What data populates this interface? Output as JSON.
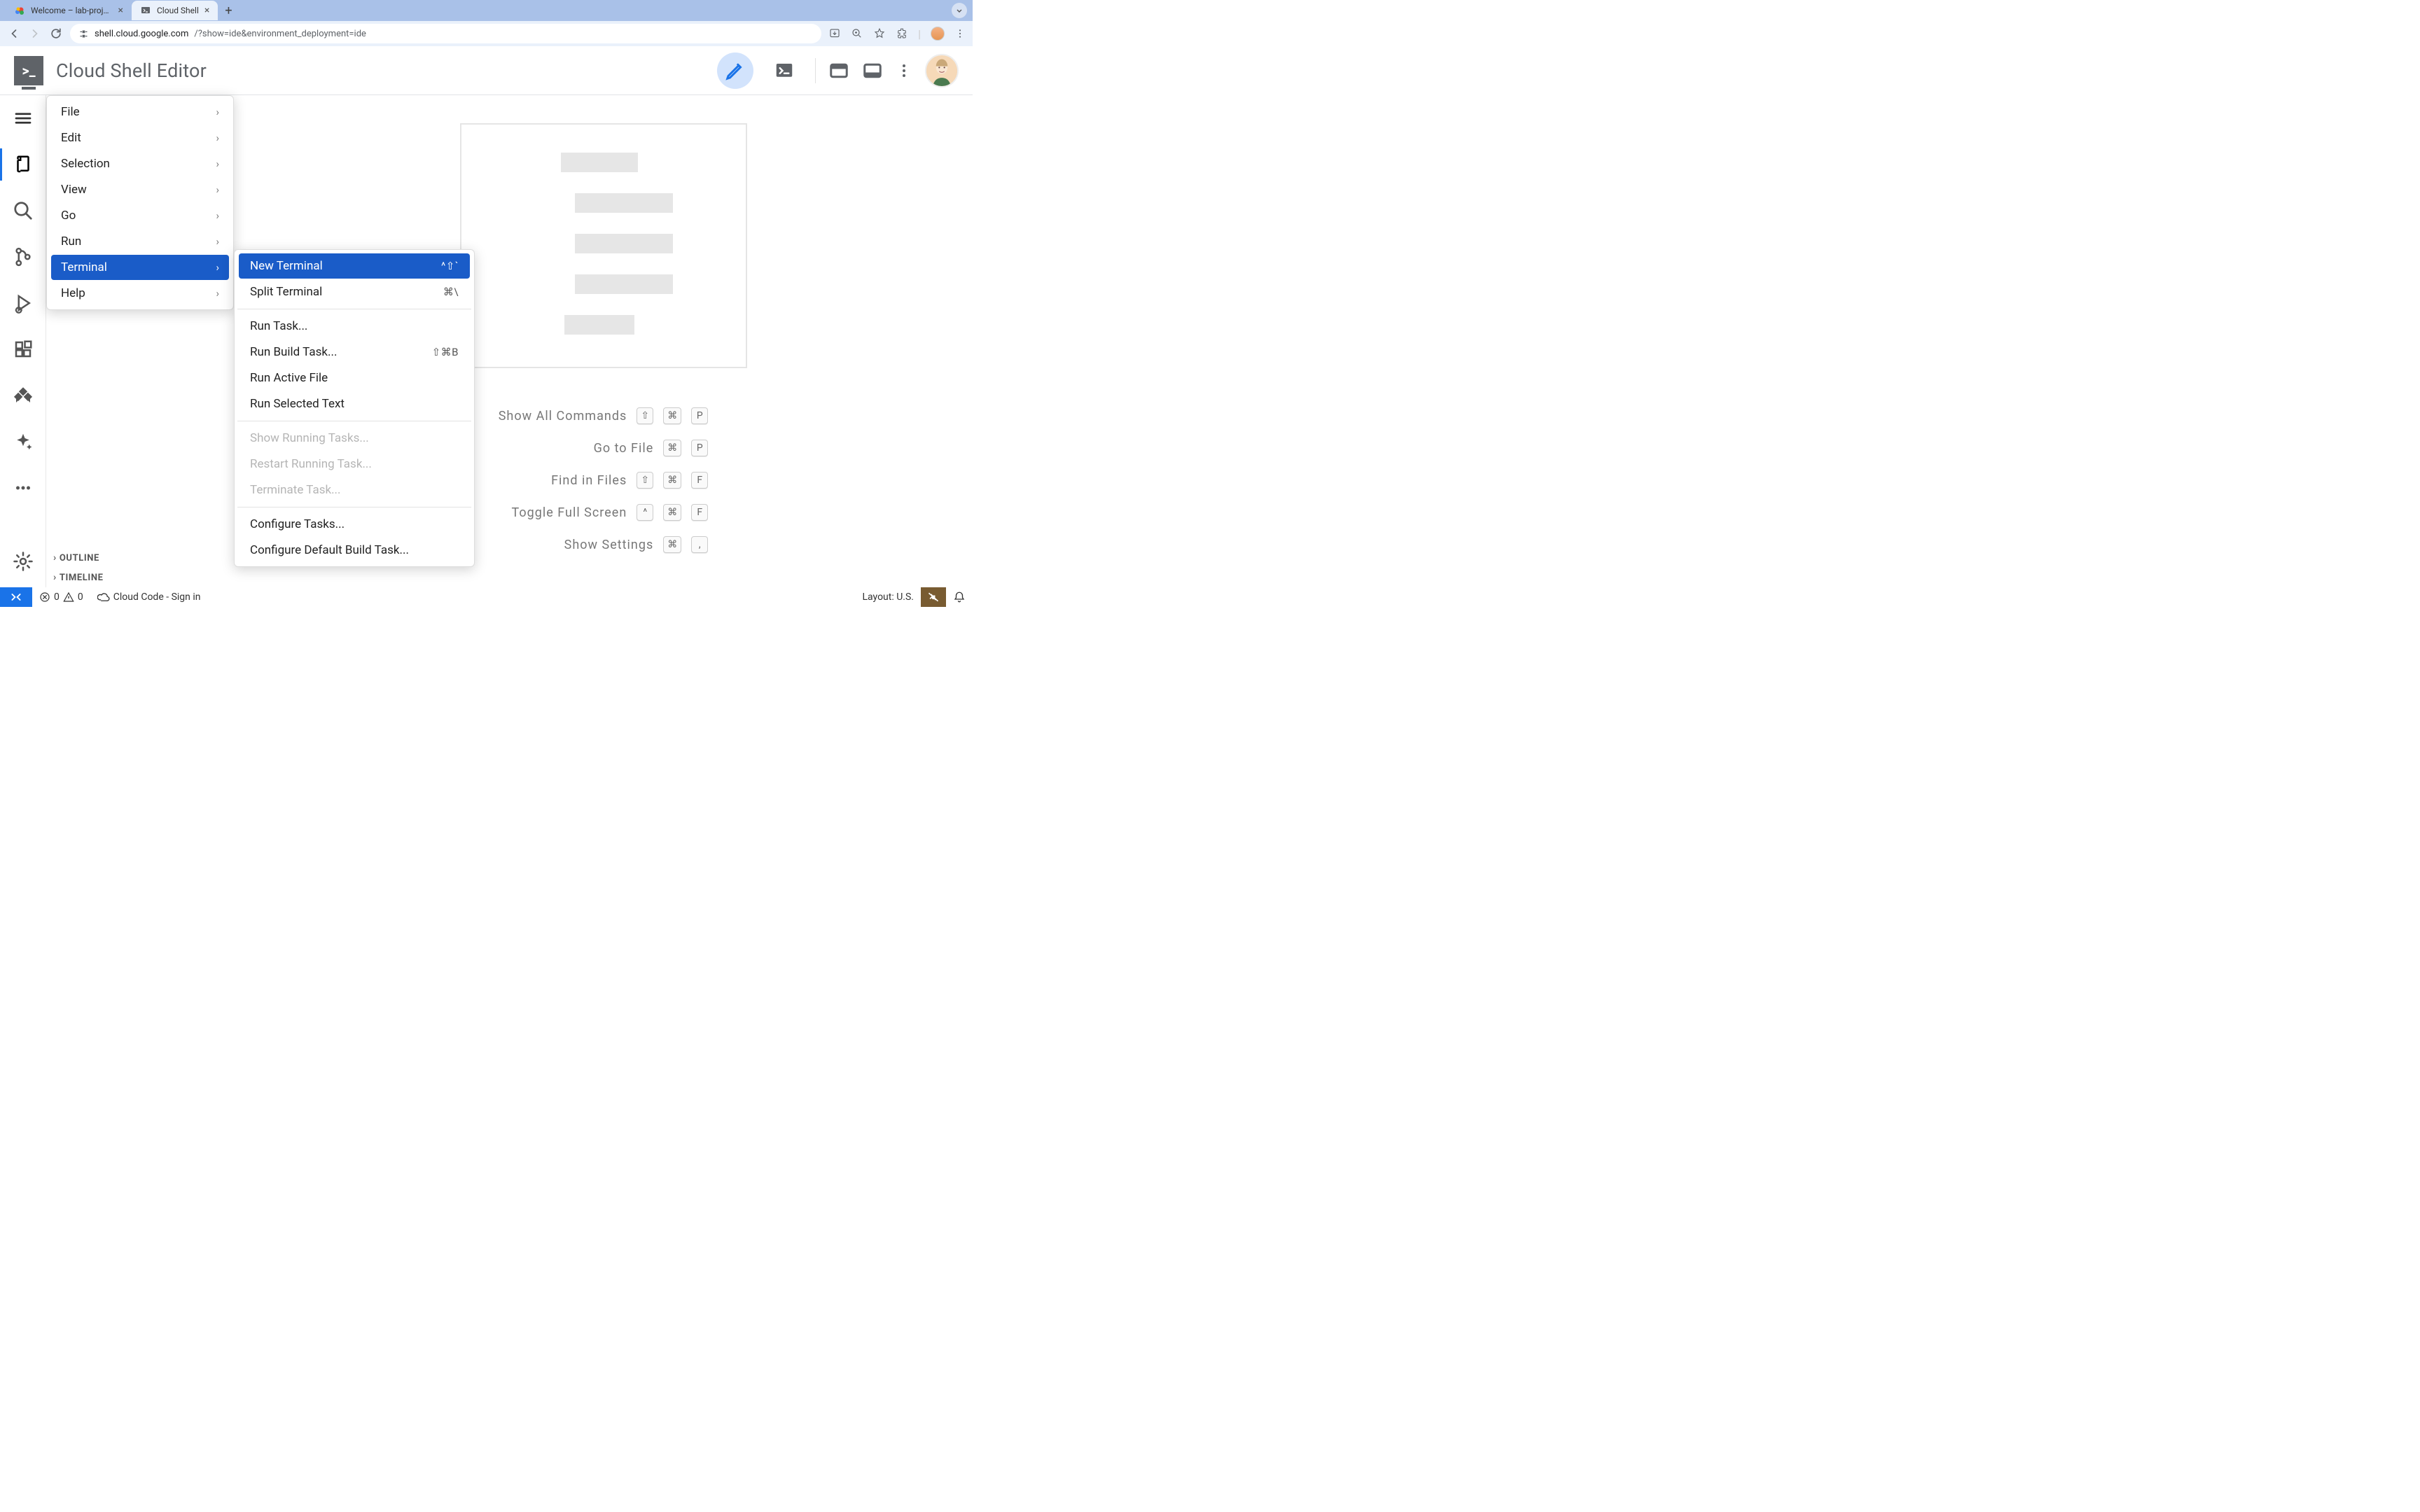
{
  "browser": {
    "tabs": [
      {
        "title": "Welcome – lab-project-id-ex",
        "active": false
      },
      {
        "title": "Cloud Shell",
        "active": true
      }
    ],
    "url_host": "shell.cloud.google.com",
    "url_path": "/?show=ide&environment_deployment=ide"
  },
  "header": {
    "title": "Cloud Shell Editor"
  },
  "menu": {
    "items": [
      {
        "label": "File"
      },
      {
        "label": "Edit"
      },
      {
        "label": "Selection"
      },
      {
        "label": "View"
      },
      {
        "label": "Go"
      },
      {
        "label": "Run"
      },
      {
        "label": "Terminal",
        "highlight": true
      },
      {
        "label": "Help"
      }
    ]
  },
  "submenu": {
    "groups": [
      [
        {
          "label": "New Terminal",
          "shortcut": "^⇧`",
          "highlight": true
        },
        {
          "label": "Split Terminal",
          "shortcut": "⌘\\"
        }
      ],
      [
        {
          "label": "Run Task..."
        },
        {
          "label": "Run Build Task...",
          "shortcut": "⇧⌘B"
        },
        {
          "label": "Run Active File"
        },
        {
          "label": "Run Selected Text"
        }
      ],
      [
        {
          "label": "Show Running Tasks...",
          "disabled": true
        },
        {
          "label": "Restart Running Task...",
          "disabled": true
        },
        {
          "label": "Terminate Task...",
          "disabled": true
        }
      ],
      [
        {
          "label": "Configure Tasks..."
        },
        {
          "label": "Configure Default Build Task..."
        }
      ]
    ]
  },
  "hints": [
    {
      "label": "Show All Commands",
      "keys": [
        "⇧",
        "⌘",
        "P"
      ]
    },
    {
      "label": "Go to File",
      "keys": [
        "⌘",
        "P"
      ]
    },
    {
      "label": "Find in Files",
      "keys": [
        "⇧",
        "⌘",
        "F"
      ]
    },
    {
      "label": "Toggle Full Screen",
      "keys": [
        "^",
        "⌘",
        "F"
      ]
    },
    {
      "label": "Show Settings",
      "keys": [
        "⌘",
        ","
      ]
    }
  ],
  "explorer_sections": {
    "outline": "OUTLINE",
    "timeline": "TIMELINE"
  },
  "status": {
    "errors": "0",
    "warnings": "0",
    "cloudcode": "Cloud Code - Sign in",
    "layout": "Layout: U.S."
  }
}
